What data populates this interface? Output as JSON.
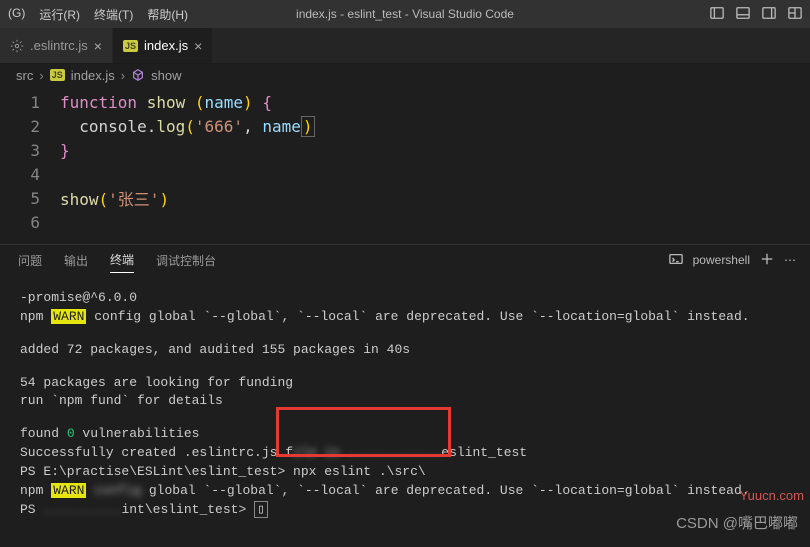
{
  "menu": {
    "run": "运行(R)",
    "terminal": "终端(T)",
    "help": "帮助(H)"
  },
  "title": "index.js - eslint_test - Visual Studio Code",
  "tabs": [
    {
      "label": ".eslintrc.js",
      "active": false
    },
    {
      "label": "index.js",
      "active": true
    }
  ],
  "breadcrumb": {
    "seg1": "src",
    "seg2": "index.js",
    "seg3": "show"
  },
  "code": {
    "l1": {
      "n": "1",
      "kw": "function",
      "fn": "show",
      "lp": "(",
      "param": "name",
      "rp": ")",
      "lb": "{"
    },
    "l2": {
      "n": "2",
      "obj": "console",
      "dot": ".",
      "fn": "log",
      "lp": "(",
      "s": "'666'",
      "comma": ", ",
      "param": "name",
      "rp": ")"
    },
    "l3": {
      "n": "3",
      "rb": "}"
    },
    "l4": {
      "n": "4"
    },
    "l5": {
      "n": "5",
      "fn": "show",
      "lp": "(",
      "s": "'张三'",
      "rp": ")"
    },
    "l6": {
      "n": "6"
    }
  },
  "panelTabs": {
    "problems": "问题",
    "output": "输出",
    "terminal": "终端",
    "debug": "调试控制台"
  },
  "shell": "powershell",
  "term": {
    "l1": "-promise@^6.0.0",
    "l2a": "npm ",
    "l2warn": "WARN",
    "l2b": " config global `--global`, `--local` are deprecated. Use `--location=global` instead.",
    "l3": "added 72 packages, and audited 155 packages in 40s",
    "l4": "54 packages are looking for funding",
    "l5": "  run `npm fund` for details",
    "l6a": "found ",
    "l6num": "0",
    "l6b": " vulnerabilities",
    "l7a": "Successfully created .eslintrc.js f",
    "l7blur": "ile in ............",
    "l7b": "eslint_test",
    "l8a": "PS E:\\practise\\ESLint\\eslint_test> ",
    "l8cmd": "npx eslint .\\src\\",
    "l9a": "npm ",
    "l9warn": "WARN",
    "l9blur": " config ",
    "l9b": "global `--global`, `--local` are deprecated. Use `--location=global` instead.",
    "l10a": "PS",
    "l10blur": " ..........",
    "l10b": "int\\eslint_test> ",
    "l10box": "▯"
  },
  "watermark": "Yuucn.com",
  "csdn": "CSDN @嘴巴嘟嘟"
}
